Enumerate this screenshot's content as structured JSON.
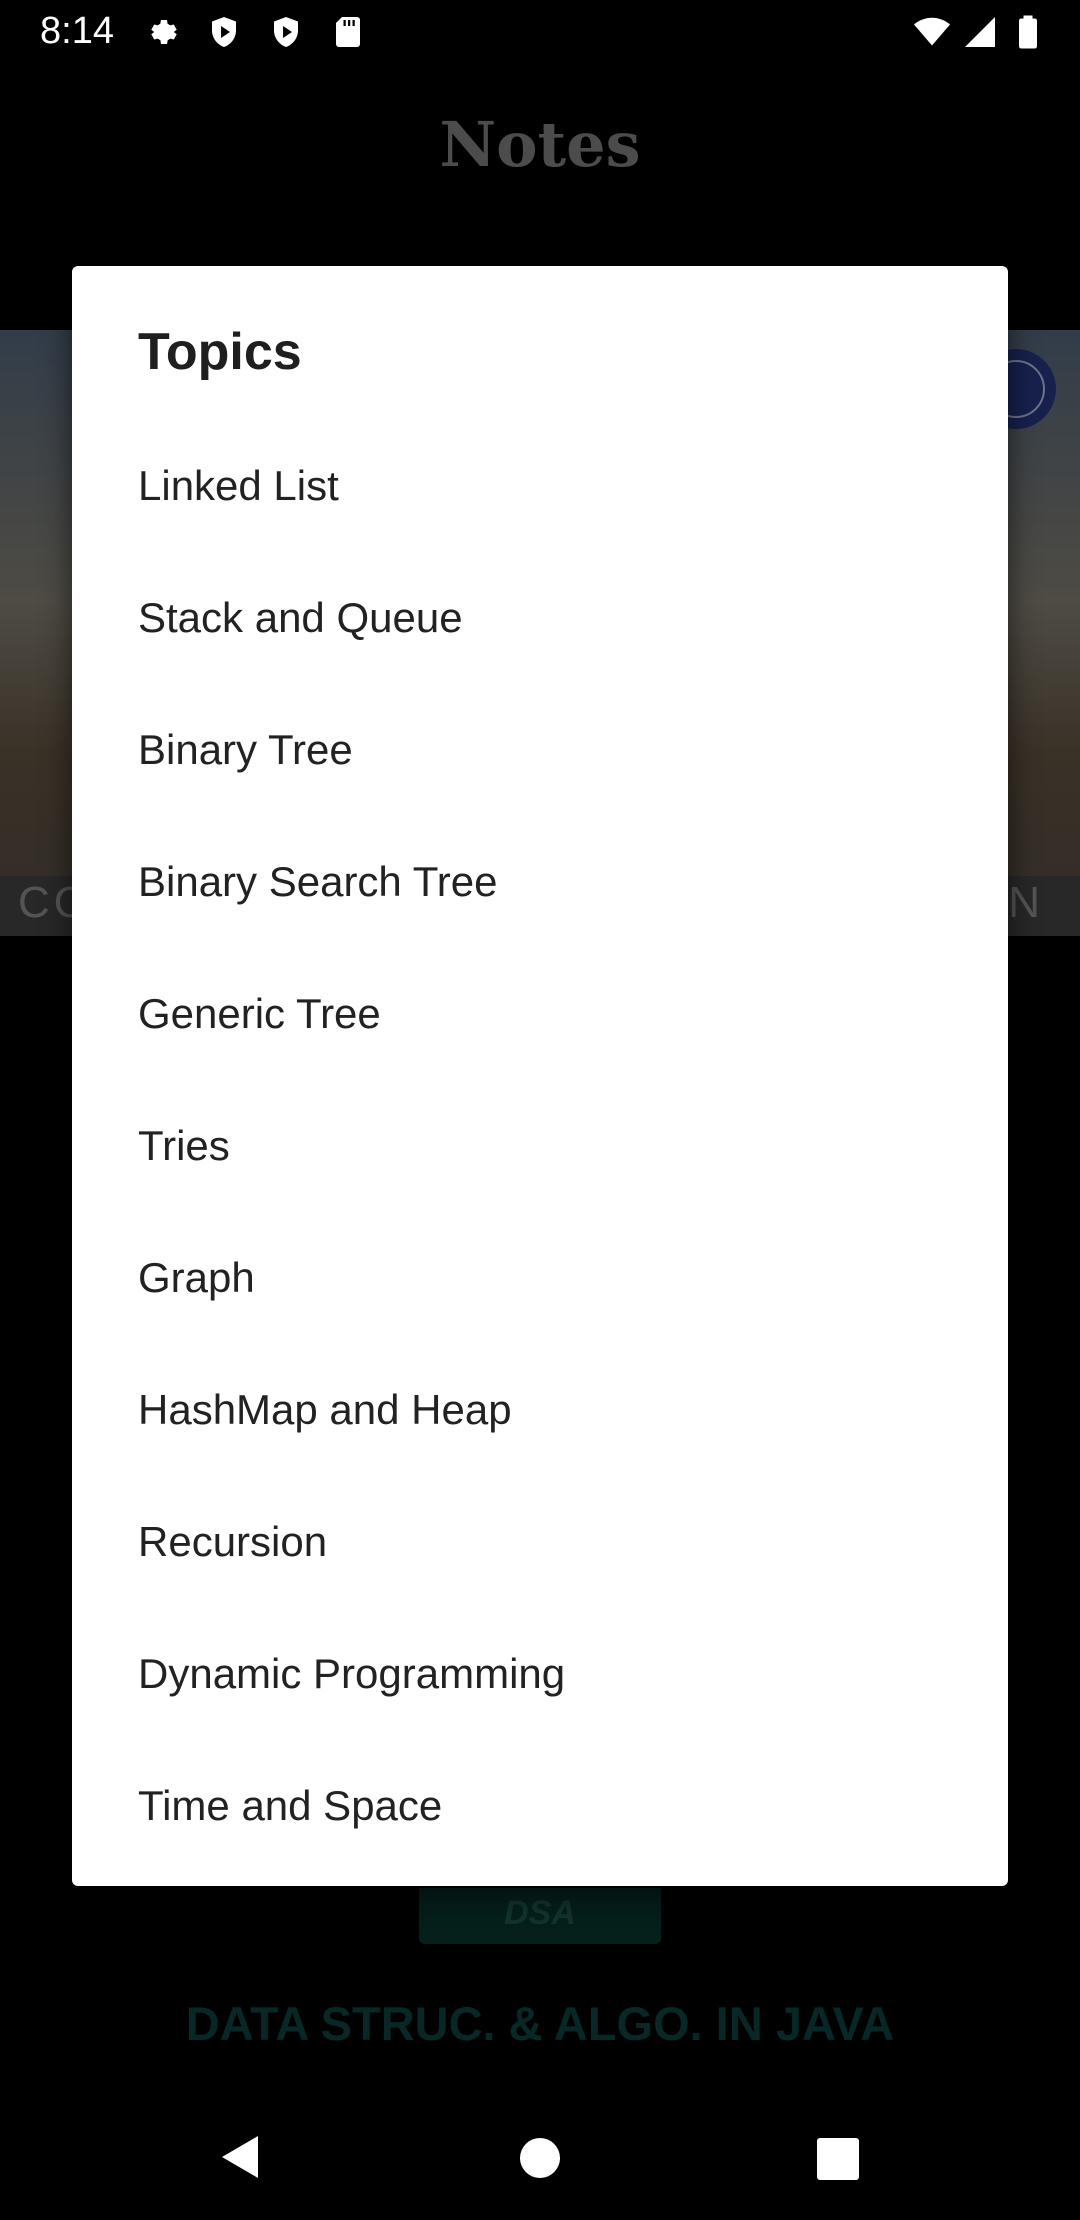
{
  "status_bar": {
    "time": "8:14",
    "icons": [
      "settings-icon",
      "play-protect-icon",
      "play-protect-icon",
      "sd-card-icon",
      "wifi-icon",
      "signal-icon",
      "battery-icon"
    ]
  },
  "app": {
    "title": "Notes",
    "banner_left_text": "CO",
    "banner_right_text": "N",
    "dsa_button": "DSA",
    "subtitle": "DATA STRUC. & ALGO. IN JAVA"
  },
  "dialog": {
    "title": "Topics",
    "items": [
      "Linked List",
      "Stack and Queue",
      "Binary Tree",
      "Binary Search Tree",
      "Generic Tree",
      "Tries",
      "Graph",
      "HashMap and Heap",
      "Recursion",
      "Dynamic Programming",
      "Time and Space"
    ]
  },
  "nav_bar": {
    "buttons": [
      "back-icon",
      "home-icon",
      "recents-icon"
    ]
  },
  "colors": {
    "dialog_bg": "#ffffff",
    "dsa_button_bg": "#0a3a32",
    "subtitle_color": "#0d4a47"
  }
}
